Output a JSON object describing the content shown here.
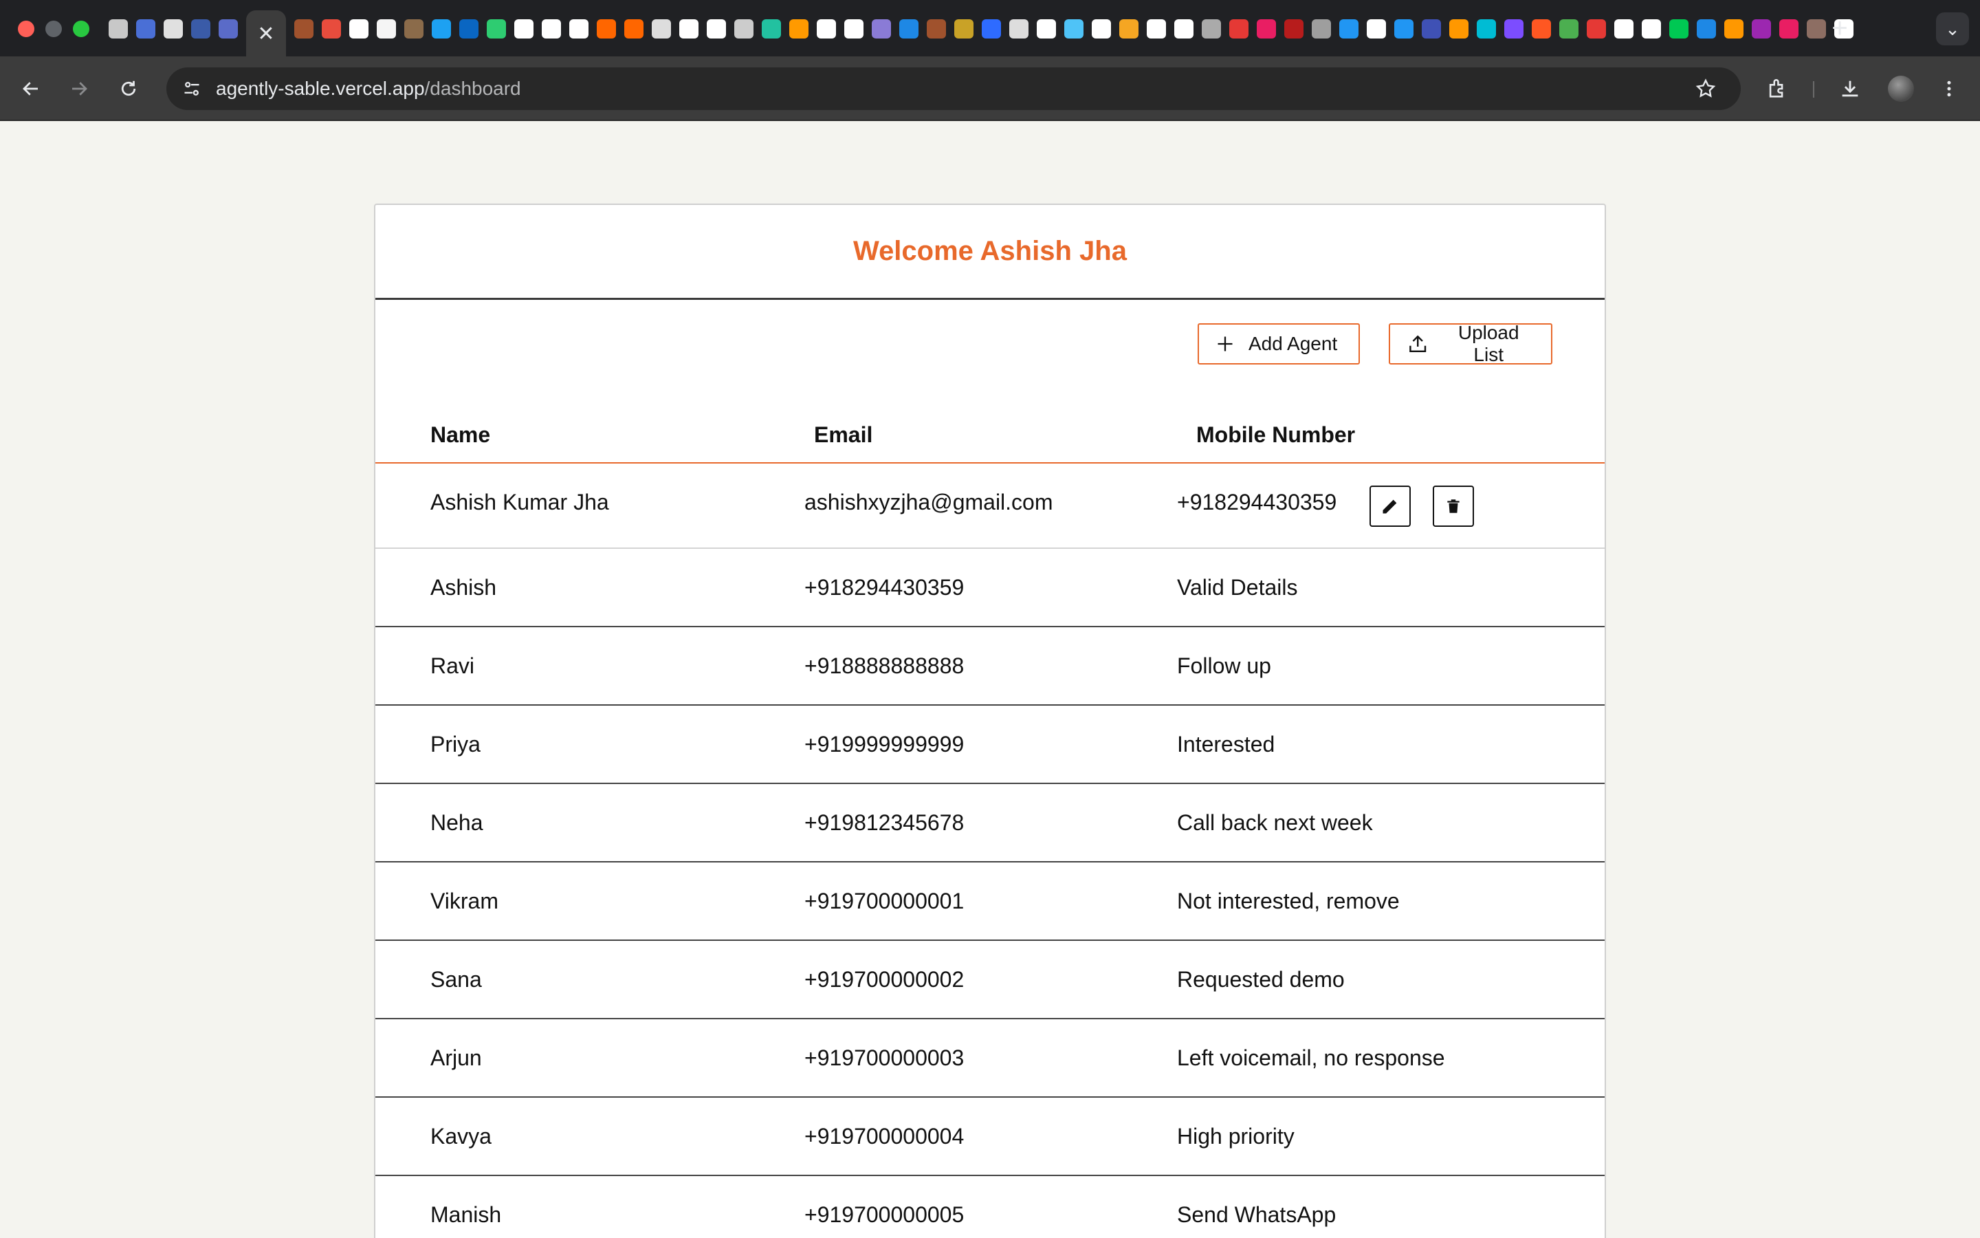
{
  "browser": {
    "url_host": "agently-sable.vercel.app",
    "url_path": "/dashboard",
    "active_tab_close": "✕",
    "new_tab": "+",
    "tab_search": "⌄",
    "favicon_colors": [
      "#c8c8c8",
      "#4a6fd6",
      "#e0e0e0",
      "#3a5ba8",
      "#5a6bc8",
      "#a0522d",
      "#e84c3d",
      "#ffffff",
      "#f5f5f5",
      "#8b6b4a",
      "#1da1f2",
      "#0a66c2",
      "#2ecc71",
      "#ffffff",
      "#ffffff",
      "#ffffff",
      "#ff6600",
      "#ff6600",
      "#dddddd",
      "#ffffff",
      "#ffffff",
      "#cccccc",
      "#22c1a0",
      "#ff9a00",
      "#ffffff",
      "#ffffff",
      "#8a7bd6",
      "#1e88e5",
      "#a0522d",
      "#c9a227",
      "#2e6bff",
      "#ddd",
      "#ffffff",
      "#4fc3f7",
      "#ffffff",
      "#f5a623",
      "#ffffff",
      "#ffffff",
      "#aaa",
      "#e53935",
      "#e91e63",
      "#b71c1c",
      "#9e9e9e",
      "#2196f3",
      "#ffffff",
      "#2196f3",
      "#3f51b5",
      "#ff9800",
      "#00bcd4",
      "#7c4dff",
      "#ff5722",
      "#4caf50",
      "#e53935",
      "#ffffff",
      "#ffffff",
      "#00c853",
      "#1e88e5",
      "#ff9800",
      "#9c27b0",
      "#e91e63",
      "#8d6e63",
      "#ffffff"
    ]
  },
  "dashboard": {
    "welcome": "Welcome Ashish Jha",
    "add_agent_label": "Add Agent",
    "upload_list_label": "Upload List",
    "columns": [
      "Name",
      "Email",
      "Mobile Number"
    ],
    "rows": [
      {
        "name": "Ashish Kumar Jha",
        "email": "ashishxyzjha@gmail.com",
        "mobile": "+918294430359"
      },
      {
        "name": "Ashish",
        "email": "+918294430359",
        "mobile": "Valid Details"
      },
      {
        "name": "Ravi",
        "email": "+918888888888",
        "mobile": "Follow up"
      },
      {
        "name": "Priya",
        "email": "+919999999999",
        "mobile": "Interested"
      },
      {
        "name": "Neha",
        "email": "+919812345678",
        "mobile": "Call back next week"
      },
      {
        "name": "Vikram",
        "email": "+919700000001",
        "mobile": "Not interested, remove"
      },
      {
        "name": "Sana",
        "email": "+919700000002",
        "mobile": "Requested demo"
      },
      {
        "name": "Arjun",
        "email": "+919700000003",
        "mobile": "Left voicemail, no response"
      },
      {
        "name": "Kavya",
        "email": "+919700000004",
        "mobile": "High priority"
      },
      {
        "name": "Manish",
        "email": "+919700000005",
        "mobile": "Send WhatsApp"
      }
    ]
  },
  "colors": {
    "accent": "#e8692b",
    "page_bg": "#f4f4ef"
  }
}
